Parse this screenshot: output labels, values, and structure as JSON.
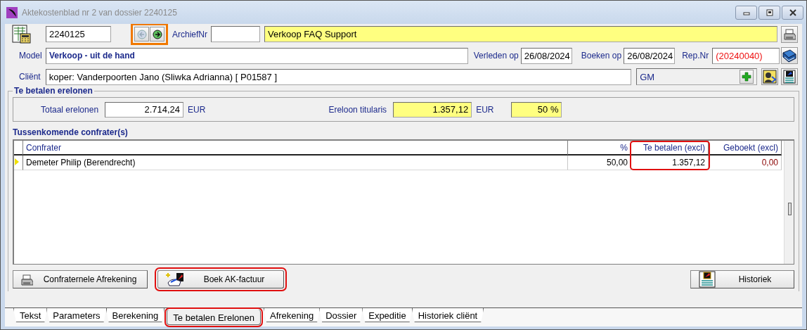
{
  "window": {
    "title": "Aktekostenblad nr 2 van dossier 2240125"
  },
  "header": {
    "dossier": "2240125",
    "nav_highlighted": true,
    "archief_label": "ArchiefNr",
    "subject": "Verkoop FAQ Support",
    "model_label": "Model",
    "model": "Verkoop - uit de hand",
    "verleden_label": "Verleden op",
    "verleden": "26/08/2024",
    "boeken_label": "Boeken op",
    "boeken": "26/08/2024",
    "rep_label": "Rep.Nr",
    "rep": "(20240040)",
    "client_label": "Cliënt",
    "client": "koper: Vanderpoorten Jano (Sliwka Adrianna) [ P01587 ]",
    "group": "GM"
  },
  "fees": {
    "title": "Te betalen erelonen",
    "total_label": "Totaal erelonen",
    "total": "2.714,24",
    "total_unit": "EUR",
    "titular_label": "Ereloon titularis",
    "titular": "1.357,12",
    "titular_unit": "EUR",
    "titular_share": "50 %"
  },
  "confraters": {
    "title": "Tussenkomende confrater(s)",
    "columns": [
      {
        "label": "Confrater",
        "highlighted": false
      },
      {
        "label": "%",
        "highlighted": false
      },
      {
        "label": "Te betalen (excl)",
        "highlighted": true
      },
      {
        "label": "Geboekt (excl)",
        "highlighted": false
      }
    ],
    "rows": [
      {
        "selected": true,
        "cells": [
          "Demeter Philip (Berendrecht)",
          "50,00",
          "1.357,12",
          "0,00"
        ]
      }
    ]
  },
  "buttons": [
    {
      "label": "Confraternele Afrekening",
      "kind": "print",
      "highlighted": false
    },
    {
      "label": "Boek AK-factuur",
      "kind": "book",
      "highlighted": true
    },
    {
      "label": "Historiek",
      "kind": "history",
      "highlighted": false
    }
  ],
  "tabs": [
    {
      "label": "Tekst",
      "selected": false,
      "highlighted": false
    },
    {
      "label": "Parameters",
      "selected": false,
      "highlighted": false
    },
    {
      "label": "Berekening",
      "selected": false,
      "highlighted": false
    },
    {
      "label": "Te betalen Erelonen",
      "selected": true,
      "highlighted": true
    },
    {
      "label": "Afrekening",
      "selected": false,
      "highlighted": false
    },
    {
      "label": "Dossier",
      "selected": false,
      "highlighted": false
    },
    {
      "label": "Expeditie",
      "selected": false,
      "highlighted": false
    },
    {
      "label": "Historiek cliënt",
      "selected": false,
      "highlighted": false
    }
  ]
}
